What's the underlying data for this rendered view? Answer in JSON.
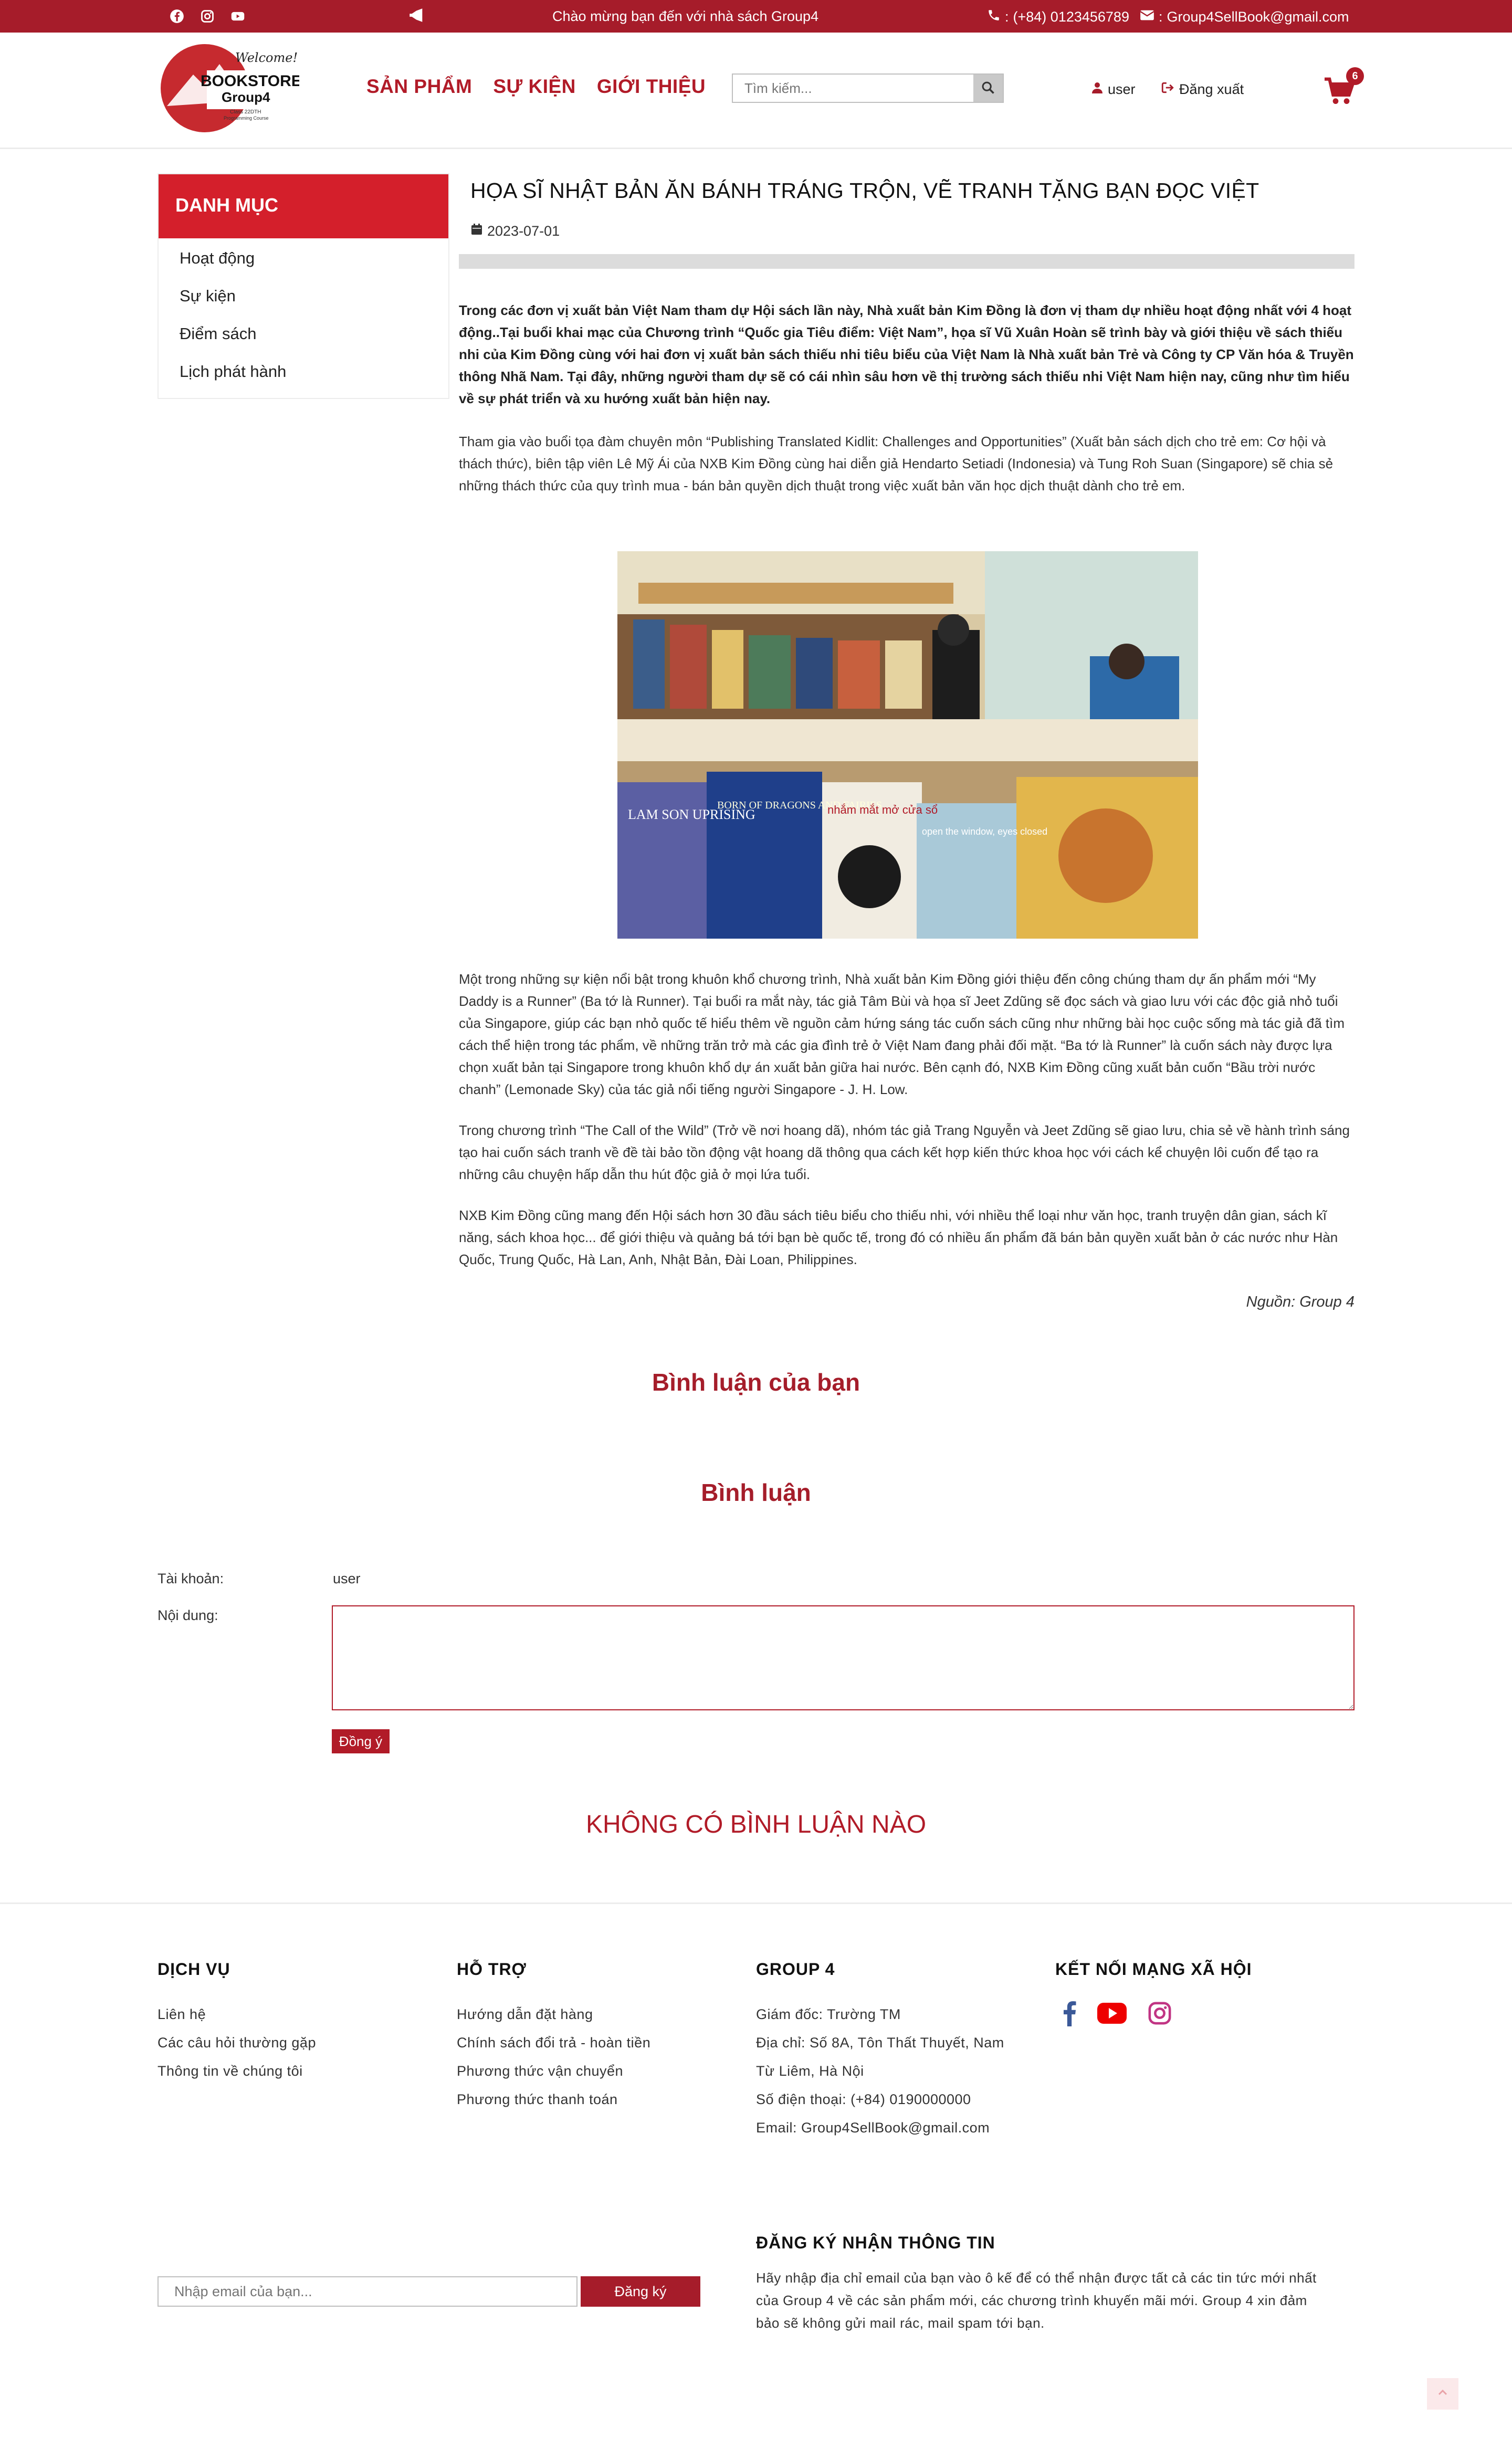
{
  "topbar": {
    "welcome": "Chào mừng bạn đến với nhà sách Group4",
    "phone": "(+84) 0123456789",
    "email": "Group4SellBook@gmail.com",
    "bg_color": "#a61c2a"
  },
  "header": {
    "logo": {
      "welcome": "Welcome!",
      "brand": "BOOKSTORE",
      "sub": "Group4",
      "tagline": "Class 22DTH",
      "tagline2": "Programming Course"
    },
    "nav": [
      "SẢN PHẨM",
      "SỰ KIỆN",
      "GIỚI THIỆU"
    ],
    "search_placeholder": "Tìm kiếm...",
    "user": "user",
    "logout": "Đăng xuất",
    "cart_count": "6"
  },
  "sidebar": {
    "title": "DANH MỤC",
    "items": [
      "Hoạt động",
      "Sự kiện",
      "Điểm sách",
      "Lịch phát hành"
    ]
  },
  "article": {
    "title": "HỌA SĨ NHẬT BẢN ĂN BÁNH TRÁNG TRỘN, VẼ TRANH TẶNG BẠN ĐỌC VIỆT",
    "date": "2023-07-01",
    "lead": "Trong các đơn vị xuất bản Việt Nam tham dự Hội sách lần này, Nhà xuất bản Kim Đồng là đơn vị tham dự nhiều hoạt động nhất với 4 hoạt động..Tại buổi khai mạc của Chương trình “Quốc gia Tiêu điểm: Việt Nam”, họa sĩ Vũ Xuân Hoàn sẽ trình bày và giới thiệu về sách thiếu nhi của Kim Đồng cùng với hai đơn vị xuất bản sách thiếu nhi tiêu biểu của Việt Nam là Nhà xuất bản Trẻ và Công ty CP Văn hóa & Truyền thông Nhã Nam. Tại đây, những người tham dự sẽ có cái nhìn sâu hơn về thị trường sách thiếu nhi Việt Nam hiện nay, cũng như tìm hiểu về sự phát triển và xu hướng xuất bản hiện nay.",
    "para1": "Tham gia vào buổi tọa đàm chuyên môn “Publishing Translated Kidlit: Challenges and Opportunities” (Xuất bản sách dịch cho trẻ em: Cơ hội và thách thức), biên tập viên Lê Mỹ Ái của NXB Kim Đồng cùng hai diễn giả Hendarto Setiadi (Indonesia) và Tung Roh Suan (Singapore) sẽ chia sẻ những thách thức của quy trình mua - bán bản quyền dịch thuật trong việc xuất bản văn học dịch thuật dành cho trẻ em.",
    "photo_books": [
      "LAM SON UPRISING",
      "BORN OF DRAGONS AND FAIRIES",
      "nhắm mắt mở cửa sổ",
      "open the window, eyes closed"
    ],
    "para2": "Một trong những sự kiện nổi bật trong khuôn khổ chương trình, Nhà xuất bản Kim Đồng giới thiệu đến công chúng tham dự ấn phẩm mới “My Daddy is a Runner” (Ba tớ là Runner). Tại buổi ra mắt này, tác giả Tâm Bùi và họa sĩ Jeet Zdũng sẽ đọc sách và giao lưu với các độc giả nhỏ tuổi của Singapore, giúp các bạn nhỏ quốc tế hiểu thêm về nguồn cảm hứng sáng tác cuốn sách cũng như những bài học cuộc sống mà tác giả đã tìm cách thể hiện trong tác phẩm, về những trăn trở mà các gia đình trẻ ở Việt Nam đang phải đối mặt. “Ba tớ là Runner” là cuốn sách này được lựa chọn xuất bản tại Singapore trong khuôn khổ dự án xuất bản giữa hai nước. Bên cạnh đó, NXB Kim Đồng cũng xuất bản cuốn “Bầu trời nước chanh” (Lemonade Sky) của tác giả nổi tiếng người Singapore - J. H. Low.",
    "para3": "Trong chương trình “The Call of the Wild” (Trở về nơi hoang dã), nhóm tác giả Trang Nguyễn và Jeet Zdũng sẽ giao lưu, chia sẻ về hành trình sáng tạo hai cuốn sách tranh về đề tài bảo tồn động vật hoang dã thông qua cách kết hợp kiến thức khoa học với cách kể chuyện lôi cuốn để tạo ra những câu chuyện hấp dẫn thu hút độc giả ở mọi lứa tuổi.",
    "para4": "NXB Kim Đồng cũng mang đến Hội sách hơn 30 đầu sách tiêu biểu cho thiếu nhi, với nhiều thể loại như văn học, tranh truyện dân gian, sách kĩ năng, sách khoa học... để giới thiệu và quảng bá tới bạn bè quốc tế, trong đó có nhiều ấn phẩm đã bán bản quyền xuất bản ở các nước như Hàn Quốc, Trung Quốc, Hà Lan, Anh, Nhật Bản, Đài Loan, Philippines.",
    "source": "Nguồn: Group 4"
  },
  "comments": {
    "your_comment_title": "Bình luận của bạn",
    "form_title": "Bình luận",
    "account_label": "Tài khoản:",
    "account_value": "user",
    "content_label": "Nội dung:",
    "submit": "Đồng ý",
    "empty": "KHÔNG CÓ BÌNH LUẬN NÀO"
  },
  "footer": {
    "services": {
      "title": "DỊCH VỤ",
      "items": [
        "Liên hệ",
        "Các câu hỏi thường gặp",
        "Thông tin về chúng tôi"
      ]
    },
    "support": {
      "title": "HỖ TRỢ",
      "items": [
        "Hướng dẫn đặt hàng",
        "Chính sách đổi trả - hoàn tiền",
        "Phương thức vận chuyển",
        "Phương thức thanh toán"
      ]
    },
    "group": {
      "title": "GROUP 4",
      "items": [
        "Giám đốc: Trường TM",
        "Địa chỉ: Số 8A, Tôn Thất Thuyết, Nam",
        "Từ Liêm, Hà Nội",
        "Số điện thoại: (+84) 0190000000",
        "Email: Group4SellBook@gmail.com"
      ]
    },
    "social": {
      "title": "KẾT NỐI MẠNG XÃ HỘI"
    },
    "subscribe": {
      "title": "ĐĂNG KÝ NHẬN THÔNG TIN",
      "text": "Hãy nhập địa chỉ email của bạn vào ô kế để có thể nhận được tất cả các tin tức mới nhất của Group 4 về các sản phẩm mới, các chương trình khuyến mãi mới. Group 4 xin đảm bảo sẽ không gửi mail rác, mail spam tới bạn.",
      "placeholder": "Nhập email của bạn...",
      "button": "Đăng ký"
    }
  }
}
